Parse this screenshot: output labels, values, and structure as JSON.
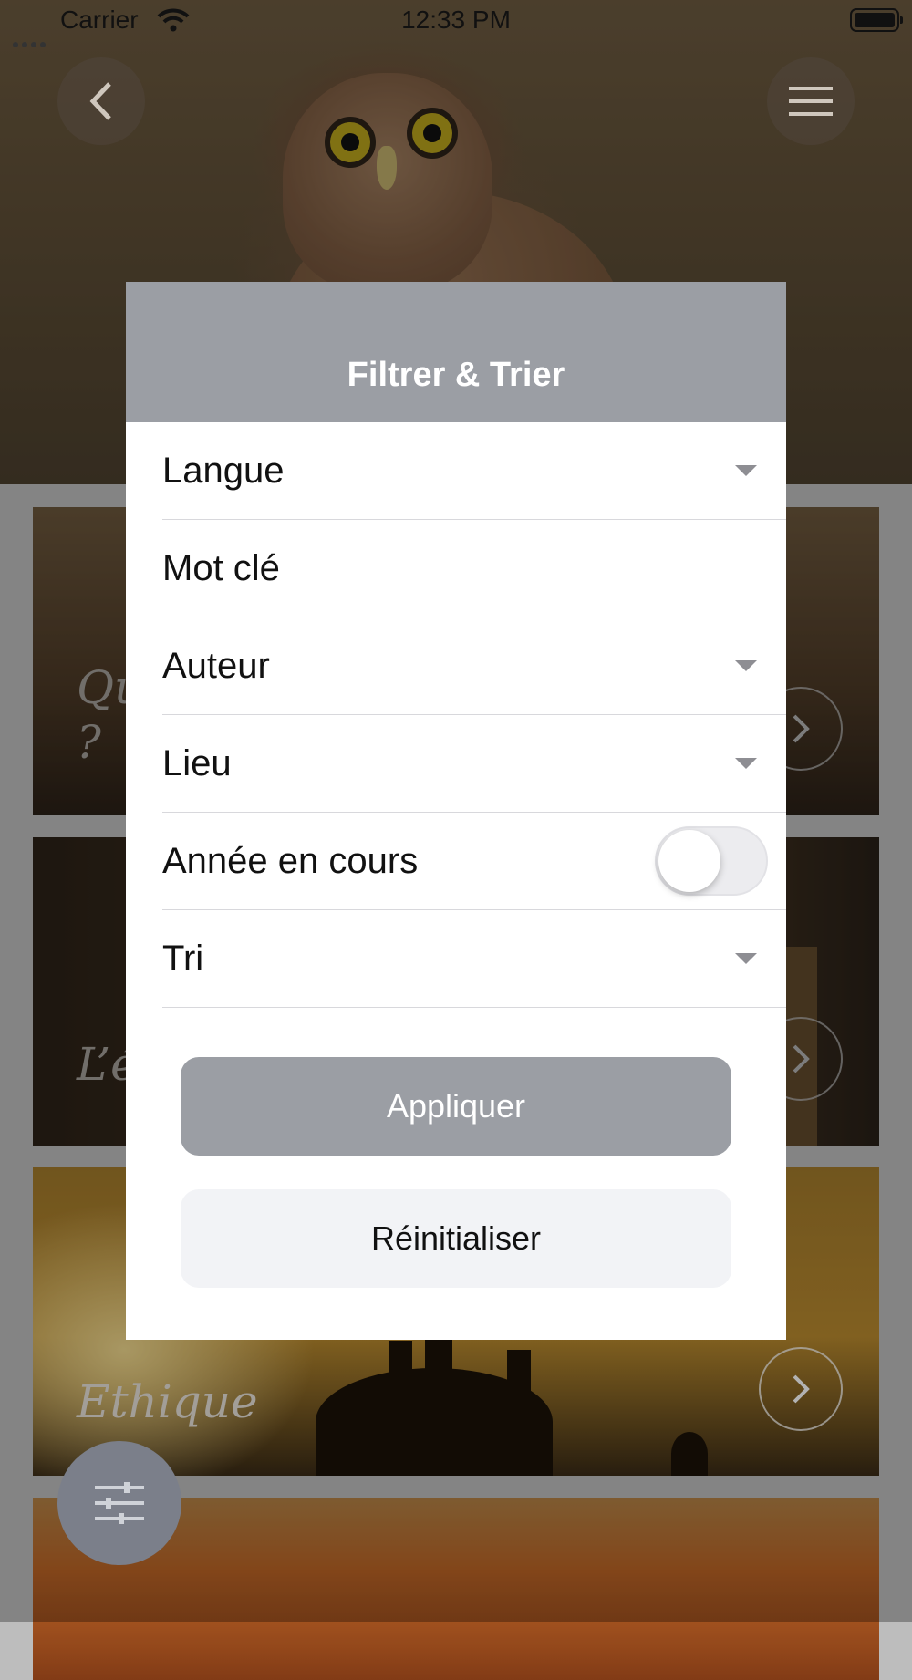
{
  "status_bar": {
    "carrier": "Carrier",
    "time": "12:33 PM"
  },
  "cards": [
    {
      "title": "Qu\n?"
    },
    {
      "title": "L’é"
    },
    {
      "title": "Ethique"
    },
    {
      "title": ""
    }
  ],
  "modal": {
    "title": "Filtrer & Trier",
    "fields": [
      {
        "label": "Langue",
        "control": "dropdown"
      },
      {
        "label": "Mot clé",
        "control": "text"
      },
      {
        "label": "Auteur",
        "control": "dropdown"
      },
      {
        "label": "Lieu",
        "control": "dropdown"
      },
      {
        "label": "Année en cours",
        "control": "toggle",
        "value": false
      },
      {
        "label": "Tri",
        "control": "dropdown"
      }
    ],
    "apply_label": "Appliquer",
    "reset_label": "Réinitialiser"
  },
  "icons": {
    "back": "chevron-left-icon",
    "menu": "hamburger-menu-icon",
    "filter": "sliders-icon",
    "card_arrow": "chevron-right-icon"
  },
  "colors": {
    "modal_header": "#9b9ea4",
    "apply_button": "#9b9ea4",
    "reset_button": "#f2f3f6",
    "fab": "#7b7f8a"
  }
}
